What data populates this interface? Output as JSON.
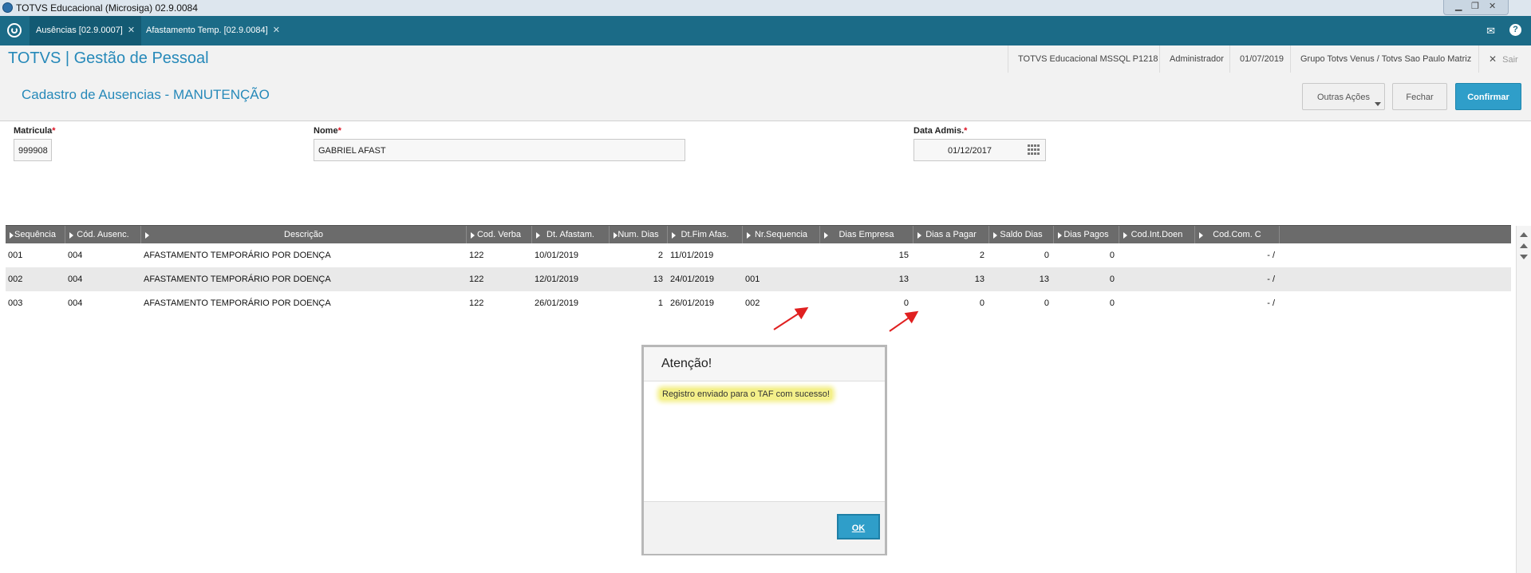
{
  "window": {
    "title": "TOTVS Educacional (Microsiga) 02.9.0084"
  },
  "tabs": [
    {
      "label": "Ausências [02.9.0007]",
      "active": true
    },
    {
      "label": "Afastamento Temp. [02.9.0084]",
      "active": false
    }
  ],
  "app": {
    "title": "TOTVS | Gestão de Pessoal",
    "info": {
      "environment": "TOTVS Educacional MSSQL P1218",
      "user": "Administrador",
      "date": "01/07/2019",
      "company": "Grupo Totvs Venus / Totvs Sao Paulo Matriz",
      "exit_label": "Sair"
    }
  },
  "form": {
    "title": "Cadastro de Ausencias - MANUTENÇÃO",
    "buttons": {
      "other_actions": "Outras Ações",
      "close": "Fechar",
      "confirm": "Confirmar"
    },
    "fields": {
      "matricula": {
        "label": "Matricula",
        "value": "999908"
      },
      "nome": {
        "label": "Nome",
        "value": "GABRIEL AFAST"
      },
      "data_admis": {
        "label": "Data Admis.",
        "value": "01/12/2017"
      }
    },
    "required_mark": "*"
  },
  "grid": {
    "columns": [
      "Sequência",
      "Cód. Ausenc.",
      "Descrição",
      "Cod. Verba",
      "Dt. Afastam.",
      "Num. Dias",
      "Dt.Fim Afas.",
      "Nr.Sequencia",
      "Dias Empresa",
      "Dias a Pagar",
      "Saldo Dias",
      "Dias Pagos",
      "Cod.Int.Doen",
      "Cod.Com. C"
    ],
    "rows": [
      [
        "001",
        "004",
        "AFASTAMENTO TEMPORÁRIO POR DOENÇA",
        "122",
        "10/01/2019",
        "2",
        "11/01/2019",
        "",
        "15",
        "2",
        "0",
        "0",
        "",
        "- /"
      ],
      [
        "002",
        "004",
        "AFASTAMENTO TEMPORÁRIO POR DOENÇA",
        "122",
        "12/01/2019",
        "13",
        "24/01/2019",
        "001",
        "13",
        "13",
        "13",
        "0",
        "",
        "- /"
      ],
      [
        "003",
        "004",
        "AFASTAMENTO TEMPORÁRIO POR DOENÇA",
        "122",
        "26/01/2019",
        "1",
        "26/01/2019",
        "002",
        "0",
        "0",
        "0",
        "0",
        "",
        "- /"
      ]
    ]
  },
  "dialog": {
    "title": "Atenção!",
    "message": "Registro enviado para o TAF com sucesso!",
    "ok_label": "OK"
  },
  "colors": {
    "tabbar": "#1b6b87",
    "accent": "#2689b9",
    "primary_button": "#2f9ec9",
    "annotation_arrow": "#e02020",
    "highlight": "#f4f08a"
  }
}
